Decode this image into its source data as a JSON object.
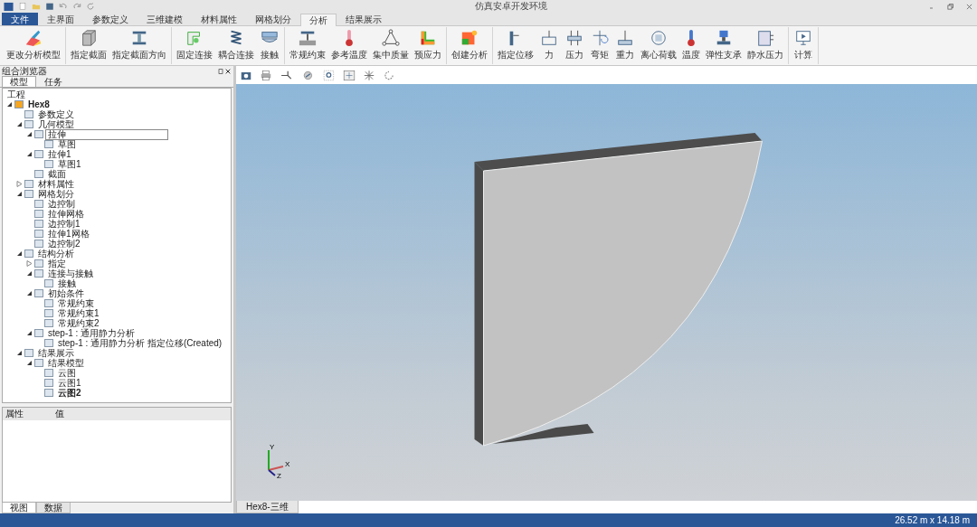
{
  "window": {
    "title": "仿真安卓开发环境"
  },
  "menu_tabs": [
    {
      "label": "文件",
      "kind": "file"
    },
    {
      "label": "主界面",
      "kind": "tab",
      "selected": false
    },
    {
      "label": "参数定义",
      "kind": "tab",
      "selected": false
    },
    {
      "label": "三维建模",
      "kind": "tab",
      "selected": false
    },
    {
      "label": "材料属性",
      "kind": "tab",
      "selected": false
    },
    {
      "label": "网格划分",
      "kind": "tab",
      "selected": false
    },
    {
      "label": "分析",
      "kind": "tab",
      "selected": true
    },
    {
      "label": "结果展示",
      "kind": "tab",
      "selected": false
    }
  ],
  "ribbon": [
    {
      "buttons": [
        "更改分析模型"
      ]
    },
    {
      "buttons": [
        "指定截面",
        "指定截面方向"
      ]
    },
    {
      "buttons": [
        "固定连接",
        "耦合连接",
        "接触"
      ]
    },
    {
      "buttons": [
        "常规约束",
        "参考温度",
        "集中质量",
        "预应力"
      ]
    },
    {
      "buttons": [
        "创建分析"
      ]
    },
    {
      "buttons": [
        "指定位移",
        "力",
        "压力",
        "弯矩",
        "重力",
        "离心荷载",
        "温度",
        "弹性支承",
        "静水压力"
      ]
    },
    {
      "buttons": [
        "计算"
      ]
    }
  ],
  "browser": {
    "title": "组合浏览器",
    "tabs": [
      {
        "label": "模型",
        "selected": true
      },
      {
        "label": "任务",
        "selected": false
      }
    ],
    "root": "工程",
    "tree": [
      {
        "label": "Hex8",
        "bold": true,
        "selected": false,
        "expanded": true,
        "children": [
          {
            "label": "参数定义",
            "selected": false
          },
          {
            "label": "几何模型",
            "selected": false,
            "expanded": true,
            "children": [
              {
                "label": "拉伸",
                "selected": true,
                "expanded": true,
                "children": [
                  {
                    "label": "草图",
                    "selected": false
                  }
                ]
              },
              {
                "label": "拉伸1",
                "selected": false,
                "expanded": true,
                "children": [
                  {
                    "label": "草图1",
                    "selected": false
                  }
                ]
              },
              {
                "label": "截面",
                "selected": false
              }
            ]
          },
          {
            "label": "材料属性",
            "selected": false,
            "expanded": false
          },
          {
            "label": "网格划分",
            "selected": false,
            "expanded": true,
            "children": [
              {
                "label": "边控制",
                "selected": false
              },
              {
                "label": "拉伸网格",
                "selected": false
              },
              {
                "label": "边控制1",
                "selected": false
              },
              {
                "label": "拉伸1网格",
                "selected": false
              },
              {
                "label": "边控制2",
                "selected": false
              }
            ]
          },
          {
            "label": "结构分析",
            "selected": false,
            "expanded": true,
            "children": [
              {
                "label": "指定",
                "selected": false,
                "expanded": false
              },
              {
                "label": "连接与接触",
                "selected": false,
                "expanded": true,
                "children": [
                  {
                    "label": "接触",
                    "selected": false
                  }
                ]
              },
              {
                "label": "初始条件",
                "selected": false,
                "expanded": true,
                "children": [
                  {
                    "label": "常规约束",
                    "selected": false
                  },
                  {
                    "label": "常规约束1",
                    "selected": false
                  },
                  {
                    "label": "常规约束2",
                    "selected": false
                  }
                ]
              },
              {
                "label": "step-1 : 通用静力分析",
                "selected": false,
                "expanded": true,
                "children": [
                  {
                    "label": "step-1 : 通用静力分析 指定位移(Created)",
                    "selected": false
                  }
                ]
              }
            ]
          },
          {
            "label": "结果展示",
            "selected": false,
            "expanded": true,
            "children": [
              {
                "label": "结果模型",
                "selected": false,
                "expanded": true,
                "children": [
                  {
                    "label": "云图",
                    "selected": false
                  },
                  {
                    "label": "云图1",
                    "selected": false
                  },
                  {
                    "label": "云图2",
                    "bold": true,
                    "selected": false
                  }
                ]
              }
            ]
          }
        ]
      }
    ]
  },
  "properties": {
    "columns": [
      "属性",
      "值"
    ]
  },
  "bottom_tabs": [
    {
      "label": "视图",
      "selected": true
    },
    {
      "label": "数据",
      "selected": false
    }
  ],
  "viewport": {
    "axes": [
      "Y",
      "X",
      "Z"
    ],
    "tab": "Hex8-三维"
  },
  "status_bar": {
    "size": "26.52 m x 14.18 m"
  }
}
